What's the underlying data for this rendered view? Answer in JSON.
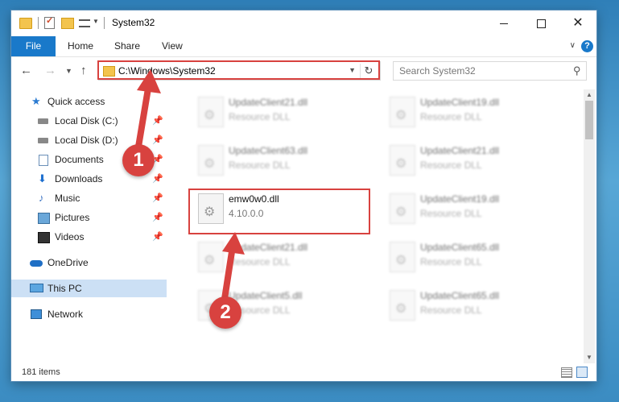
{
  "window": {
    "title": "System32",
    "controls": {
      "minimize_icon": "minimize-icon",
      "maximize_icon": "maximize-icon",
      "close_symbol": "✕"
    }
  },
  "ribbon": {
    "tabs": [
      {
        "label": "File"
      },
      {
        "label": "Home"
      },
      {
        "label": "Share"
      },
      {
        "label": "View"
      }
    ],
    "help_symbol": "?"
  },
  "address_bar": {
    "path": "C:\\Windows\\System32"
  },
  "search": {
    "placeholder": "Search System32"
  },
  "sidebar": {
    "items": [
      {
        "label": "Quick access",
        "icon": "star-icon"
      },
      {
        "label": "Local Disk (C:)",
        "icon": "disk-icon",
        "pinned": true
      },
      {
        "label": "Local Disk (D:)",
        "icon": "disk-icon",
        "pinned": true
      },
      {
        "label": "Documents",
        "icon": "documents-icon",
        "pinned": true
      },
      {
        "label": "Downloads",
        "icon": "download-icon",
        "pinned": true
      },
      {
        "label": "Music",
        "icon": "music-icon",
        "pinned": true
      },
      {
        "label": "Pictures",
        "icon": "pictures-icon",
        "pinned": true
      },
      {
        "label": "Videos",
        "icon": "videos-icon",
        "pinned": true
      },
      {
        "label": "OneDrive",
        "icon": "cloud-icon"
      },
      {
        "label": "This PC",
        "icon": "pc-icon",
        "selected": true
      },
      {
        "label": "Network",
        "icon": "network-icon"
      }
    ]
  },
  "files": [
    {
      "name": "UpdateClient21.dll",
      "type": "Resource DLL"
    },
    {
      "name": "UpdateClient19.dll",
      "type": "Resource DLL"
    },
    {
      "name": "UpdateClient63.dll",
      "type": "Resource DLL"
    },
    {
      "name": "UpdateClient21.dll",
      "type": "Resource DLL"
    },
    {
      "name": "emw0w0.dll",
      "type": "4.10.0.0"
    },
    {
      "name": "UpdateClient19.dll",
      "type": "Resource DLL"
    },
    {
      "name": "UpdateClient21.dll",
      "type": "Resource DLL"
    },
    {
      "name": "UpdateClient65.dll",
      "type": "Resource DLL"
    },
    {
      "name": "UpdateClient5.dll",
      "type": "Resource DLL"
    },
    {
      "name": "UpdateClient65.dll",
      "type": "Resource DLL"
    }
  ],
  "status": {
    "item_count": "181 items"
  },
  "annotations": {
    "step1": "1",
    "step2": "2",
    "color": "#d8423f"
  },
  "colors": {
    "accent": "#1979ca",
    "selection": "#cce0f5",
    "highlight": "#d8423f"
  }
}
